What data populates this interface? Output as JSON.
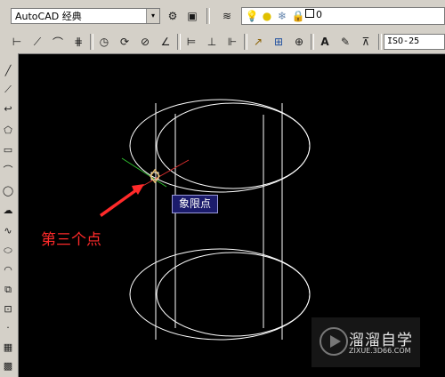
{
  "toolbar": {
    "workspace_value": "AutoCAD 经典",
    "workspace_arrow": "▾",
    "layer_value": "0",
    "dimstyle_value": "ISO-25",
    "icons_row1": [
      {
        "name": "workspace-settings-icon",
        "glyph": "⚙"
      },
      {
        "name": "toolpalette-icon",
        "glyph": "▣"
      },
      {
        "name": "layer-manager-icon",
        "glyph": "≋"
      },
      {
        "name": "lightbulb-icon",
        "glyph": "💡"
      },
      {
        "name": "sun-icon",
        "glyph": "●"
      },
      {
        "name": "freeze-icon",
        "glyph": "❄"
      },
      {
        "name": "lock-icon",
        "glyph": "🔒"
      }
    ],
    "icons_row2": [
      {
        "name": "linear-dim-icon",
        "glyph": "⊢"
      },
      {
        "name": "aligned-dim-icon",
        "glyph": "⟋"
      },
      {
        "name": "arc-length-icon",
        "glyph": "⌒"
      },
      {
        "name": "ordinate-dim-icon",
        "glyph": "⋕"
      },
      {
        "name": "radius-dim-icon",
        "glyph": "◷"
      },
      {
        "name": "jogged-dim-icon",
        "glyph": "⟳"
      },
      {
        "name": "diameter-dim-icon",
        "glyph": "⊘"
      },
      {
        "name": "angular-dim-icon",
        "glyph": "∠"
      },
      {
        "name": "quick-dim-icon",
        "glyph": "⊨"
      },
      {
        "name": "baseline-dim-icon",
        "glyph": "⊥"
      },
      {
        "name": "continue-dim-icon",
        "glyph": "⊩"
      },
      {
        "name": "quick-leader-icon",
        "glyph": "↗"
      },
      {
        "name": "tolerance-icon",
        "glyph": "⊞"
      },
      {
        "name": "center-mark-icon",
        "glyph": "⊕"
      },
      {
        "name": "dim-edit-icon",
        "glyph": "A"
      },
      {
        "name": "dim-text-edit-icon",
        "glyph": "✎"
      },
      {
        "name": "dim-update-icon",
        "glyph": "⊼"
      }
    ]
  },
  "left_tools": [
    {
      "name": "line-tool-icon",
      "glyph": "╱"
    },
    {
      "name": "construction-line-icon",
      "glyph": "⟋"
    },
    {
      "name": "polyline-tool-icon",
      "glyph": "↩"
    },
    {
      "name": "polygon-tool-icon",
      "glyph": "⬠"
    },
    {
      "name": "rectangle-tool-icon",
      "glyph": "▭"
    },
    {
      "name": "arc-tool-icon",
      "glyph": "⌒"
    },
    {
      "name": "circle-tool-icon",
      "glyph": "◯"
    },
    {
      "name": "revcloud-tool-icon",
      "glyph": "☁"
    },
    {
      "name": "spline-tool-icon",
      "glyph": "∿"
    },
    {
      "name": "ellipse-tool-icon",
      "glyph": "⬭"
    },
    {
      "name": "ellipse-arc-tool-icon",
      "glyph": "◠"
    },
    {
      "name": "insert-block-icon",
      "glyph": "⧉"
    },
    {
      "name": "make-block-icon",
      "glyph": "⊡"
    },
    {
      "name": "point-tool-icon",
      "glyph": "·"
    },
    {
      "name": "hatch-tool-icon",
      "glyph": "▦"
    },
    {
      "name": "gradient-tool-icon",
      "glyph": "▩"
    }
  ],
  "canvas": {
    "osnap_tooltip": "象限点",
    "annotation": "第三个点",
    "watermark_name": "溜溜自学",
    "watermark_url": "ZIXUE.3D66.COM"
  },
  "colors": {
    "canvas_bg": "#000000",
    "drawing_lines": "#ffffff",
    "annotation": "#ff2a2a",
    "tooltip_bg": "#1b1b6b",
    "crosshair_x": "#e03030",
    "crosshair_y": "#30c030",
    "snap_marker": "#e8c070"
  }
}
